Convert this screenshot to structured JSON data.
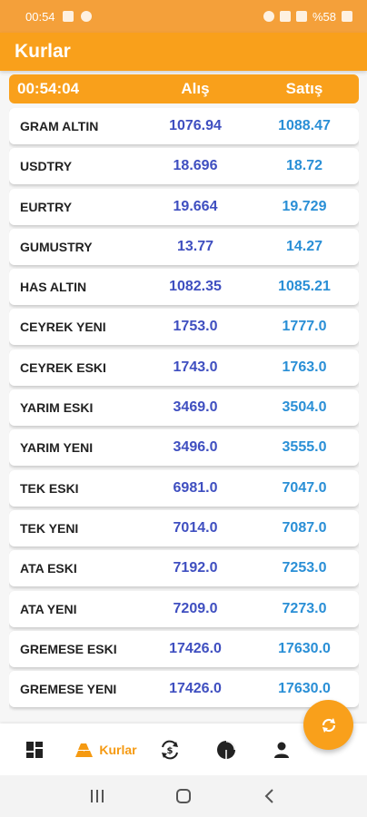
{
  "status_bar": {
    "time": "00:54",
    "battery": "%58"
  },
  "app_bar": {
    "title": "Kurlar"
  },
  "header": {
    "time": "00:54:04",
    "buy_label": "Alış",
    "sell_label": "Satış"
  },
  "rates": [
    {
      "name": "GRAM ALTIN",
      "buy": "1076.94",
      "sell": "1088.47"
    },
    {
      "name": "USDTRY",
      "buy": "18.696",
      "sell": "18.72"
    },
    {
      "name": "EURTRY",
      "buy": "19.664",
      "sell": "19.729"
    },
    {
      "name": "GUMUSTRY",
      "buy": "13.77",
      "sell": "14.27"
    },
    {
      "name": "HAS ALTIN",
      "buy": "1082.35",
      "sell": "1085.21"
    },
    {
      "name": "CEYREK YENI",
      "buy": "1753.0",
      "sell": "1777.0"
    },
    {
      "name": "CEYREK ESKI",
      "buy": "1743.0",
      "sell": "1763.0"
    },
    {
      "name": "YARIM ESKI",
      "buy": "3469.0",
      "sell": "3504.0"
    },
    {
      "name": "YARIM YENI",
      "buy": "3496.0",
      "sell": "3555.0"
    },
    {
      "name": "TEK ESKI",
      "buy": "6981.0",
      "sell": "7047.0"
    },
    {
      "name": "TEK YENI",
      "buy": "7014.0",
      "sell": "7087.0"
    },
    {
      "name": "ATA ESKI",
      "buy": "7192.0",
      "sell": "7253.0"
    },
    {
      "name": "ATA YENI",
      "buy": "7209.0",
      "sell": "7273.0"
    },
    {
      "name": "GREMESE ESKI",
      "buy": "17426.0",
      "sell": "17630.0"
    },
    {
      "name": "GREMESE YENI",
      "buy": "17426.0",
      "sell": "17630.0"
    }
  ],
  "bottom_nav": {
    "items": [
      {
        "icon": "dashboard-icon"
      },
      {
        "icon": "gold-bars-icon",
        "label": "Kurlar"
      },
      {
        "icon": "currency-exchange-icon"
      },
      {
        "icon": "pie-chart-icon"
      },
      {
        "icon": "person-icon"
      }
    ]
  },
  "fab": {
    "icon": "refresh-icon"
  },
  "colors": {
    "accent": "#f9a01b",
    "buy": "#3f4fc0",
    "sell": "#2a8fd6"
  }
}
